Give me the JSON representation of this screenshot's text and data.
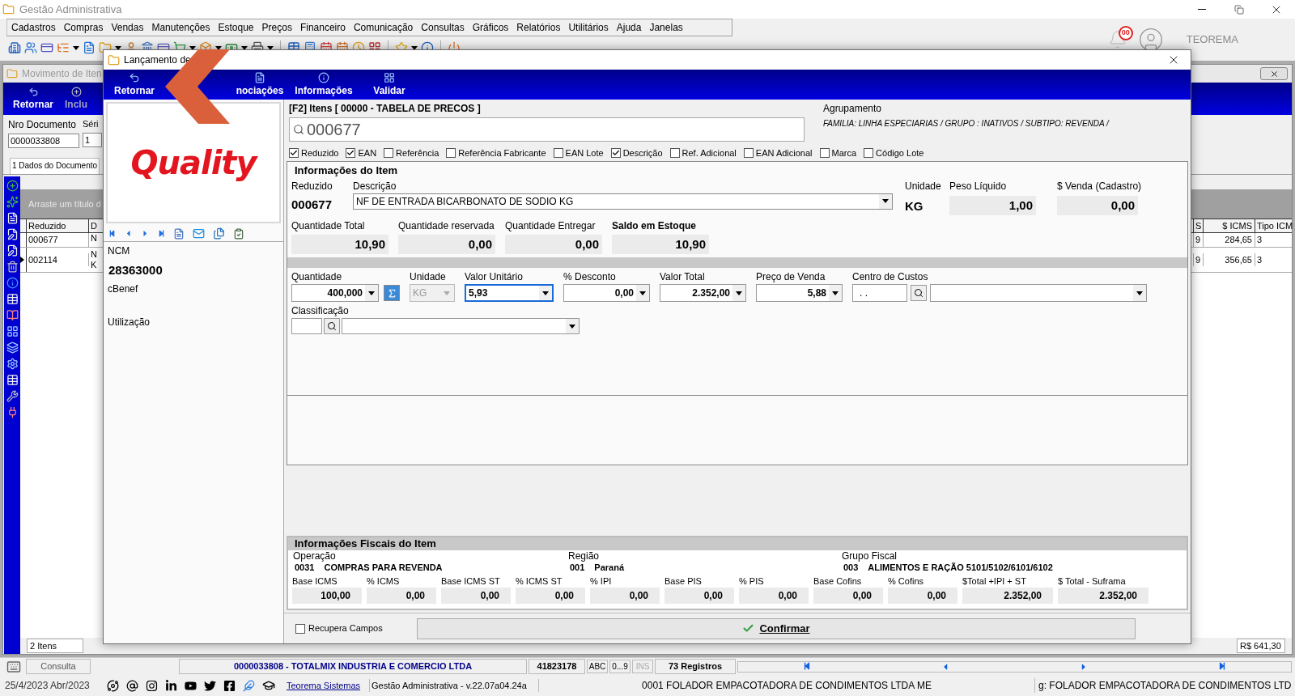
{
  "app": {
    "title": "Gestão Administrativa",
    "user": "TEOREMA",
    "notifications": "00",
    "menu": [
      "Cadastros",
      "Compras",
      "Vendas",
      "Manutenções",
      "Estoque",
      "Preços",
      "Financeiro",
      "Comunicação",
      "Consultas",
      "Gráficos",
      "Relatórios",
      "Utilitários",
      "Ajuda",
      "Janelas"
    ]
  },
  "movement_window": {
    "title": "Movimento de Iten",
    "toolbar": [
      "Retornar",
      "Inclu"
    ],
    "document": {
      "label": "Nro Documento",
      "value": "0000033808"
    },
    "series": {
      "label": "Séri",
      "value": "1"
    },
    "tab": {
      "label": "1 Dados do Documento",
      "selected": true
    },
    "group_hint": "Arraste um título d",
    "table": {
      "columns": [
        "Reduzido",
        "D"
      ],
      "right_columns": [
        "S",
        "$ ICMS",
        "Tipo ICM"
      ],
      "rows": [
        {
          "selected": false,
          "reduzido": "000677",
          "column_2": [
            "N"
          ],
          "right_cells": [
            "9",
            "284,65",
            "3"
          ]
        },
        {
          "selected": true,
          "reduzido": "002114",
          "column_2": [
            "N",
            "K"
          ],
          "right_cells": [
            "9",
            "356,65",
            "3"
          ]
        }
      ]
    },
    "item_count": "2 Itens",
    "total": "R$ 641,30"
  },
  "dialog": {
    "title": "Lançamento de",
    "toolbar": [
      {
        "label": "Retornar"
      },
      {
        "label": "nociações"
      },
      {
        "label": "Informações"
      },
      {
        "label": "Validar"
      }
    ],
    "logo": "Quality",
    "ncm_label": "NCM",
    "ncm": "28363000",
    "cbenef_label": "cBenef",
    "usage_label": "Utilização",
    "search": {
      "title": "[F2] Itens [ 00000 - TABELA DE PRECOS ]",
      "value": "000677",
      "filters": [
        {
          "label": "Reduzido",
          "checked": true
        },
        {
          "label": "EAN",
          "checked": true
        },
        {
          "label": "Referência",
          "checked": false
        },
        {
          "label": "Referência Fabricante",
          "checked": false
        },
        {
          "label": "EAN Lote",
          "checked": false
        },
        {
          "label": "Descrição",
          "checked": true
        },
        {
          "label": "Ref. Adicional",
          "checked": false
        },
        {
          "label": "EAN Adicional",
          "checked": false
        },
        {
          "label": "Marca",
          "checked": false
        },
        {
          "label": "Código Lote",
          "checked": false
        }
      ]
    },
    "grouping": {
      "label": "Agrupamento",
      "value": "FAMILIA: LINHA ESPECIARIAS / GRUPO : INATIVOS / SUBTIPO: REVENDA /"
    },
    "item_info": {
      "title": "Informações do Item",
      "reduzido_label": "Reduzido",
      "reduzido": "000677",
      "description_label": "Descrição",
      "description": "NF DE ENTRADA BICARBONATO DE SODIO KG",
      "unit_label": "Unidade",
      "unit": "KG",
      "weight_label": "Peso Líquido",
      "weight": "1,00",
      "price_label": "$ Venda (Cadastro)",
      "price": "0,00",
      "quantities": [
        {
          "label": "Quantidade Total",
          "value": "10,90",
          "bold": false
        },
        {
          "label": "Quantidade reservada",
          "value": "0,00",
          "bold": false
        },
        {
          "label": "Quantidade Entregar",
          "value": "0,00",
          "bold": false
        },
        {
          "label": "Saldo em Estoque",
          "value": "10,90",
          "bold": true
        }
      ]
    },
    "entry": [
      {
        "kind": "number",
        "label": "Quantidade",
        "value": "400,000",
        "focused": false,
        "sum_button": true
      },
      {
        "kind": "unit",
        "label": "Unidade",
        "value": "KG",
        "disabled": true
      },
      {
        "kind": "number",
        "label": "Valor Unitário",
        "value": "5,93",
        "focused": true
      },
      {
        "kind": "number",
        "label": "% Desconto",
        "value": "0,00",
        "focused": false
      },
      {
        "kind": "number",
        "label": "Valor Total",
        "value": "2.352,00",
        "focused": false
      },
      {
        "kind": "number",
        "label": "Preço de Venda",
        "value": "5,88",
        "focused": false
      },
      {
        "kind": "cost_center",
        "label": "Centro de Custos",
        "value": ". ."
      }
    ],
    "classification_label": "Classificação",
    "fiscal": {
      "title": "Informações Fiscais do Item",
      "groups": [
        {
          "label": "Operação",
          "code": "0031",
          "name": "COMPRAS PARA REVENDA"
        },
        {
          "label": "Região",
          "code": "001",
          "name": "Paraná"
        },
        {
          "label": "Grupo Fiscal",
          "code": "003",
          "name": "ALIMENTOS E RAÇÃO 5101/5102/6101/6102"
        }
      ],
      "values": [
        {
          "label": "Base ICMS",
          "value": "100,00"
        },
        {
          "label": "% ICMS",
          "value": "0,00"
        },
        {
          "label": "Base ICMS ST",
          "value": "0,00"
        },
        {
          "label": "% ICMS ST",
          "value": "0,00"
        },
        {
          "label": "% IPI",
          "value": "0,00"
        },
        {
          "label": "Base PIS",
          "value": "0,00"
        },
        {
          "label": "% PIS",
          "value": "0,00"
        },
        {
          "label": "Base Cofins",
          "value": "0,00"
        },
        {
          "label": "% Cofins",
          "value": "0,00"
        },
        {
          "label": "$Total +IPI + ST",
          "value": "2.352,00"
        },
        {
          "label": "$ Total - Suframa",
          "value": "2.352,00"
        }
      ]
    },
    "recover": {
      "label": "Recupera Campos",
      "checked": false
    },
    "confirm": "Confirmar"
  },
  "status_bar": {
    "mode": "Consulta",
    "document": "0000033808 - TOTALMIX INDUSTRIA E COMERCIO LTDA",
    "code": "41823178",
    "indicators": [
      {
        "label": "ABC",
        "on": true
      },
      {
        "label": "0...9",
        "on": true
      },
      {
        "label": "INS",
        "on": false
      }
    ],
    "records": "73 Registros"
  },
  "footer": {
    "date": "25/4/2023 Abr/2023",
    "link": "Teorema Sistemas",
    "version": "Gestão Administrativa - v.22.07a04.24a",
    "company": "0001 FOLADOR EMPACOTADORA DE CONDIMENTOS LTDA ME",
    "extra": "g: FOLADOR EMPACOTADORA DE CONDIMENTOS LTD"
  }
}
